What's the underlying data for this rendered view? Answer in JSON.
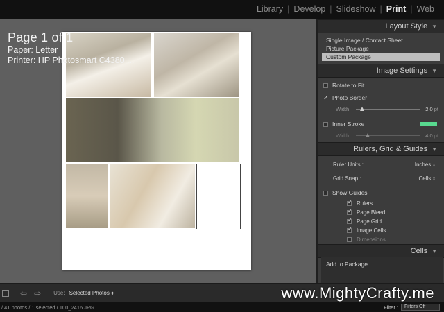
{
  "modules": [
    "Library",
    "Develop",
    "Slideshow",
    "Print",
    "Web"
  ],
  "active_module": "Print",
  "info_overlay": {
    "page": "Page 1 of 1",
    "paper": "Paper:  Letter",
    "printer": "Printer:  HP Photosmart C4380 ..."
  },
  "layout_style": {
    "title": "Layout Style",
    "items": [
      "Single Image / Contact Sheet",
      "Picture Package",
      "Custom Package"
    ],
    "selected": "Custom Package"
  },
  "image_settings": {
    "title": "Image Settings",
    "rotate_label": "Rotate to Fit",
    "photo_border_label": "Photo Border",
    "width_label": "Width",
    "width_value": "2.0",
    "width_unit": "pt",
    "inner_stroke_label": "Inner Stroke",
    "inner_stroke_color": "#58d98f",
    "stroke_width_label": "Width",
    "stroke_width_value": "4.0",
    "stroke_width_unit": "pt"
  },
  "rulers": {
    "title": "Rulers, Grid & Guides",
    "ruler_units_label": "Ruler Units :",
    "ruler_units_value": "Inches",
    "grid_snap_label": "Grid Snap :",
    "grid_snap_value": "Cells",
    "show_guides_label": "Show Guides",
    "guides": [
      {
        "label": "Rulers",
        "checked": true
      },
      {
        "label": "Page Bleed",
        "checked": true
      },
      {
        "label": "Page Grid",
        "checked": true
      },
      {
        "label": "Image Cells",
        "checked": true
      },
      {
        "label": "Dimensions",
        "checked": false
      }
    ]
  },
  "cells": {
    "title": "Cells",
    "add_to_package_label": "Add to Package"
  },
  "toolbar": {
    "use_label": "Use:",
    "use_value": "Selected Photos"
  },
  "watermark": "www.MightyCrafty.me",
  "filmstrip": {
    "count": "/ 41 photos / 1 selected / 100_2416.JPG",
    "filter_label": "Filter :",
    "filter_value": "Filters Off"
  },
  "colors": {
    "panel_bg": "#3c3c3c",
    "center_bg": "#5f5f5f",
    "selected_item_bg": "#bdbdbd",
    "inner_stroke_swatch": "#58d98f"
  }
}
